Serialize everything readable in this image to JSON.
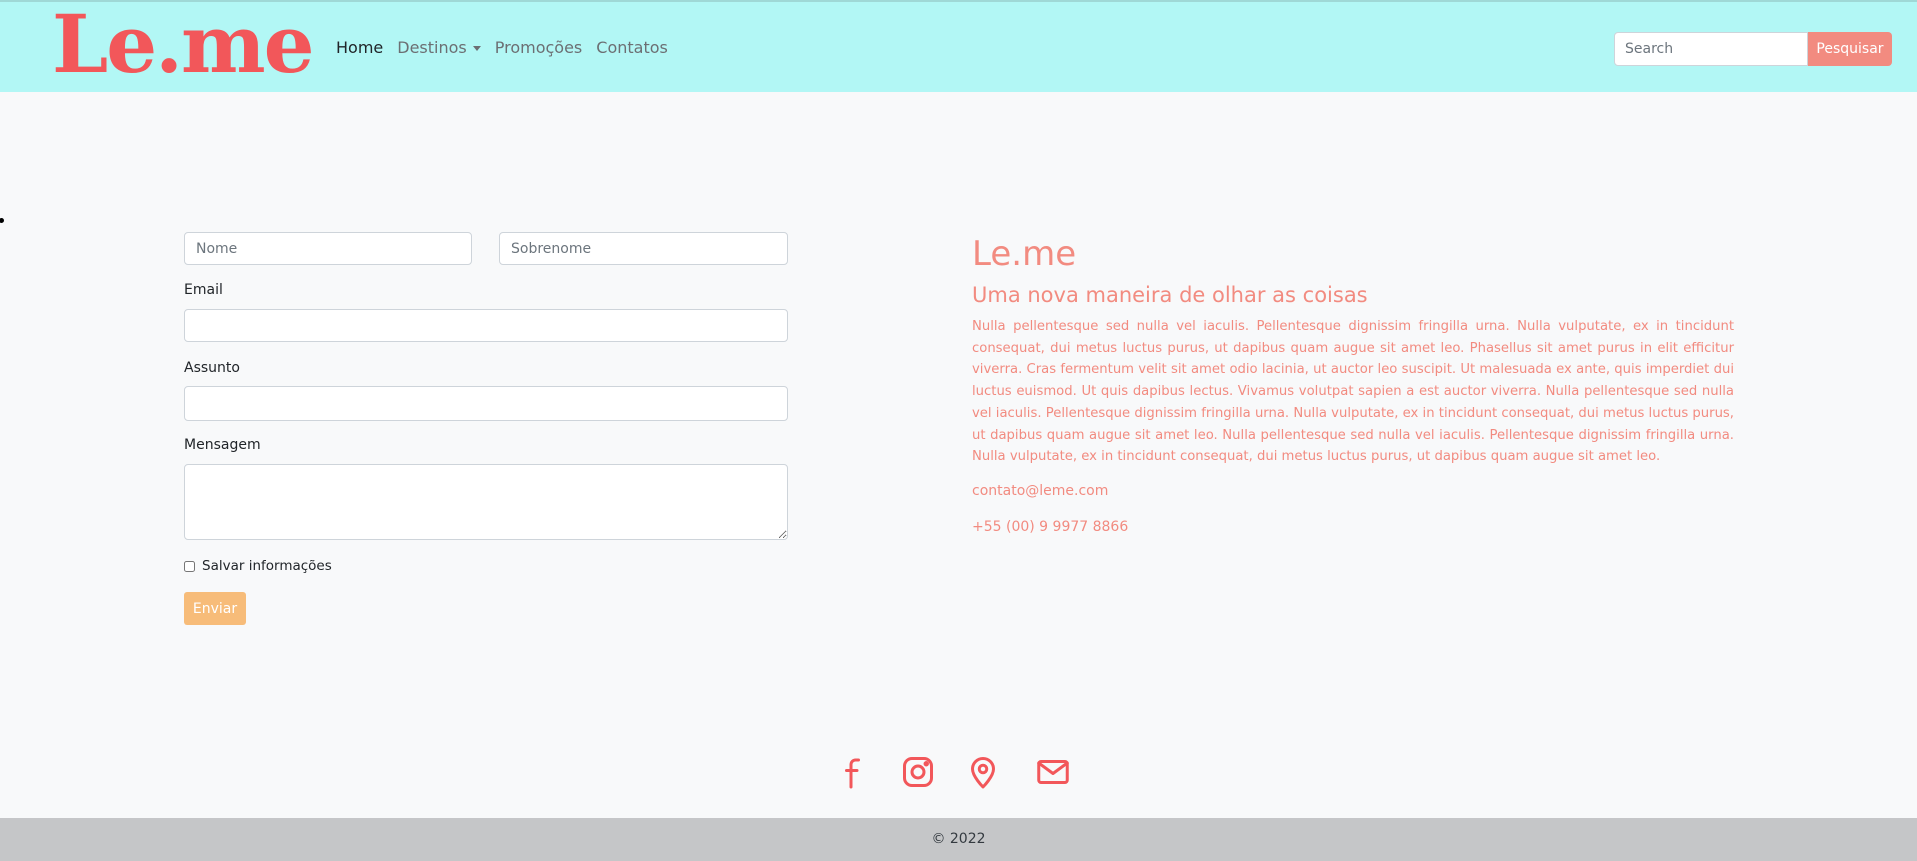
{
  "navbar": {
    "brand": "Le.me",
    "links": [
      "Home",
      "Destinos",
      "Promoções",
      "Contatos"
    ],
    "search_placeholder": "Search",
    "search_button": "Pesquisar"
  },
  "form": {
    "first_name_placeholder": "Nome",
    "last_name_placeholder": "Sobrenome",
    "email_label": "Email",
    "subject_label": "Assunto",
    "message_label": "Mensagem",
    "save_label": "Salvar informações",
    "submit_label": "Enviar"
  },
  "info": {
    "title": "Le.me",
    "subtitle": "Uma nova maneira de olhar as coisas",
    "text": "Nulla pellentesque sed nulla vel iaculis. Pellentesque dignissim fringilla urna. Nulla vulputate, ex in tincidunt consequat, dui metus luctus purus, ut dapibus quam augue sit amet leo. Phasellus sit amet purus in elit efficitur viverra. Cras fermentum velit sit amet odio lacinia, ut auctor leo suscipit. Ut malesuada ex ante, quis imperdiet dui luctus euismod. Ut quis dapibus lectus. Vivamus volutpat sapien a est auctor viverra. Nulla pellentesque sed nulla vel iaculis. Pellentesque dignissim fringilla urna. Nulla vulputate, ex in tincidunt consequat, dui metus luctus purus, ut dapibus quam augue sit amet leo. Nulla pellentesque sed nulla vel iaculis. Pellentesque dignissim fringilla urna. Nulla vulputate, ex in tincidunt consequat, dui metus luctus purus, ut dapibus quam augue sit amet leo.",
    "email": "contato@leme.com",
    "phone": "+55 (00) 9 9977 8866"
  },
  "socials": [
    "facebook-icon",
    "instagram-icon",
    "location-pin-icon",
    "mail-icon"
  ],
  "footer": {
    "copyright": "© 2022"
  },
  "colors": {
    "navbar_bg": "#b2f7f5",
    "brand": "#f2575a",
    "accent": "#f28b80",
    "submit": "#f7bc79",
    "footer_bg": "#c5c6c8"
  }
}
